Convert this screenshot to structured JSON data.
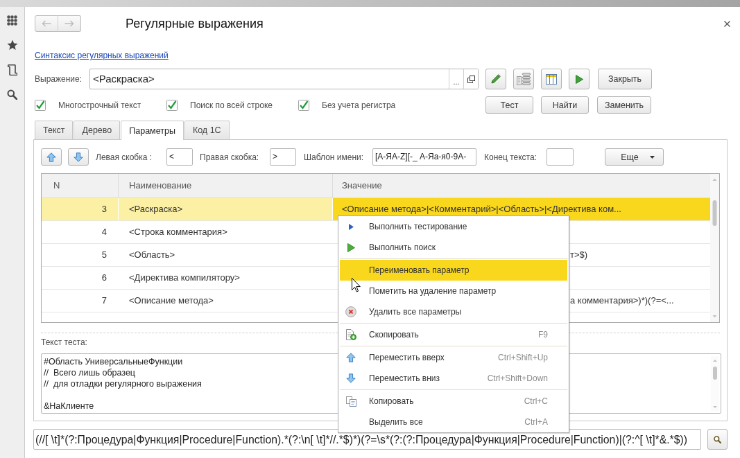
{
  "navigation": {
    "back": {
      "disabled": true
    },
    "forward": {
      "disabled": true
    }
  },
  "window": {
    "title": "Регулярные выражения"
  },
  "syntax_link": "Синтаксис регулярных выражений",
  "expression": {
    "label": "Выражение:",
    "value": "<Раскраска>",
    "select_button": "..."
  },
  "close_button": "Закрыть",
  "options": [
    {
      "label": "Многострочный текст",
      "checked": true
    },
    {
      "label": "Поиск по всей строке",
      "checked": true
    },
    {
      "label": "Без учета регистра",
      "checked": true
    }
  ],
  "action_buttons": [
    "Тест",
    "Найти",
    "Заменить"
  ],
  "tabs": [
    {
      "label": "Текст",
      "selected": false
    },
    {
      "label": "Дерево",
      "selected": false
    },
    {
      "label": "Параметры",
      "selected": true
    },
    {
      "label": "Код 1С",
      "selected": false
    }
  ],
  "parameters": {
    "fields": [
      {
        "label": "Левая скобка :",
        "value": "<"
      },
      {
        "label": "Правая скобка:",
        "value": ">"
      },
      {
        "label": "Шаблон имени:",
        "value": "[А-ЯA-Z][-_ А-Яа-я0-9A-"
      },
      {
        "label": "Конец текста:"
      }
    ],
    "more_button": "Еще",
    "table": {
      "columns": [
        "N",
        "Наименование",
        "Значение"
      ],
      "rows": [
        {
          "n": "3",
          "name": "<Раскраска>",
          "value": "<Описание метода>|<Комментарий>|<Область>|<Директива ком...",
          "selected": true
        },
        {
          "n": "4",
          "name": "<Строка комментария>",
          "selected": false
        },
        {
          "n": "5",
          "name": "<Область>",
          "value": "т>$)",
          "selected": false
        },
        {
          "n": "6",
          "name": "<Директива компилятору>",
          "selected": false
        },
        {
          "n": "7",
          "name": "<Описание метода>",
          "value": "а комментария>)*)(?=<...",
          "selected": false
        }
      ]
    },
    "test_text": {
      "label": "Текст теста:",
      "value": "#Область УниверсальныеФункции\n//  Всего лишь образец\n//  для отладки регулярного выражения\n\n&НаКлиенте"
    }
  },
  "pattern_field": {
    "value": "(//[ \\t]*(?:Процедура|Функция|Procedure|Function).*(?:\\n[ \\t]*//.*$)*)(?=\\s*(?:(?:Процедура|Функция|Procedure|Function)|(?:^[ \\t]*&.*$))"
  },
  "context_menu": {
    "groups": [
      [
        {
          "label": "Выполнить тестирование",
          "selected": false
        },
        {
          "label": "Выполнить поиск",
          "selected": false
        }
      ],
      [
        {
          "label": "Переименовать параметр",
          "selected": true
        },
        {
          "label": "Пометить на удаление параметр",
          "selected": false
        },
        {
          "label": "Удалить все параметры",
          "selected": false
        }
      ],
      [
        {
          "label": "Скопировать",
          "shortcut": "F9",
          "selected": false
        }
      ],
      [
        {
          "label": "Переместить вверх",
          "shortcut": "Ctrl+Shift+Up",
          "selected": false
        },
        {
          "label": "Переместить вниз",
          "shortcut": "Ctrl+Shift+Down",
          "selected": false
        }
      ],
      [
        {
          "label": "Копировать",
          "shortcut": "Ctrl+C",
          "selected": false
        },
        {
          "label": "Выделить все",
          "shortcut": "Ctrl+A",
          "selected": false
        }
      ]
    ]
  }
}
